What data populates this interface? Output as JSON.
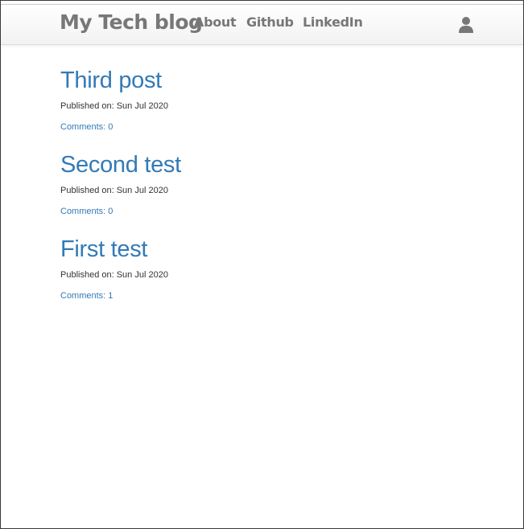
{
  "navbar": {
    "brand": "My Tech blog",
    "links": [
      {
        "label": "About"
      },
      {
        "label": "Github"
      },
      {
        "label": "LinkedIn"
      }
    ],
    "user_icon": "user-icon"
  },
  "posts": [
    {
      "title": "Third post",
      "published": "Published on: Sun Jul 2020",
      "comments": "Comments: 0"
    },
    {
      "title": "Second test",
      "published": "Published on: Sun Jul 2020",
      "comments": "Comments: 0"
    },
    {
      "title": "First test",
      "published": "Published on: Sun Jul 2020",
      "comments": "Comments: 1"
    }
  ],
  "colors": {
    "link": "#337ab7",
    "nav_text": "#777777",
    "body_text": "#333333"
  }
}
